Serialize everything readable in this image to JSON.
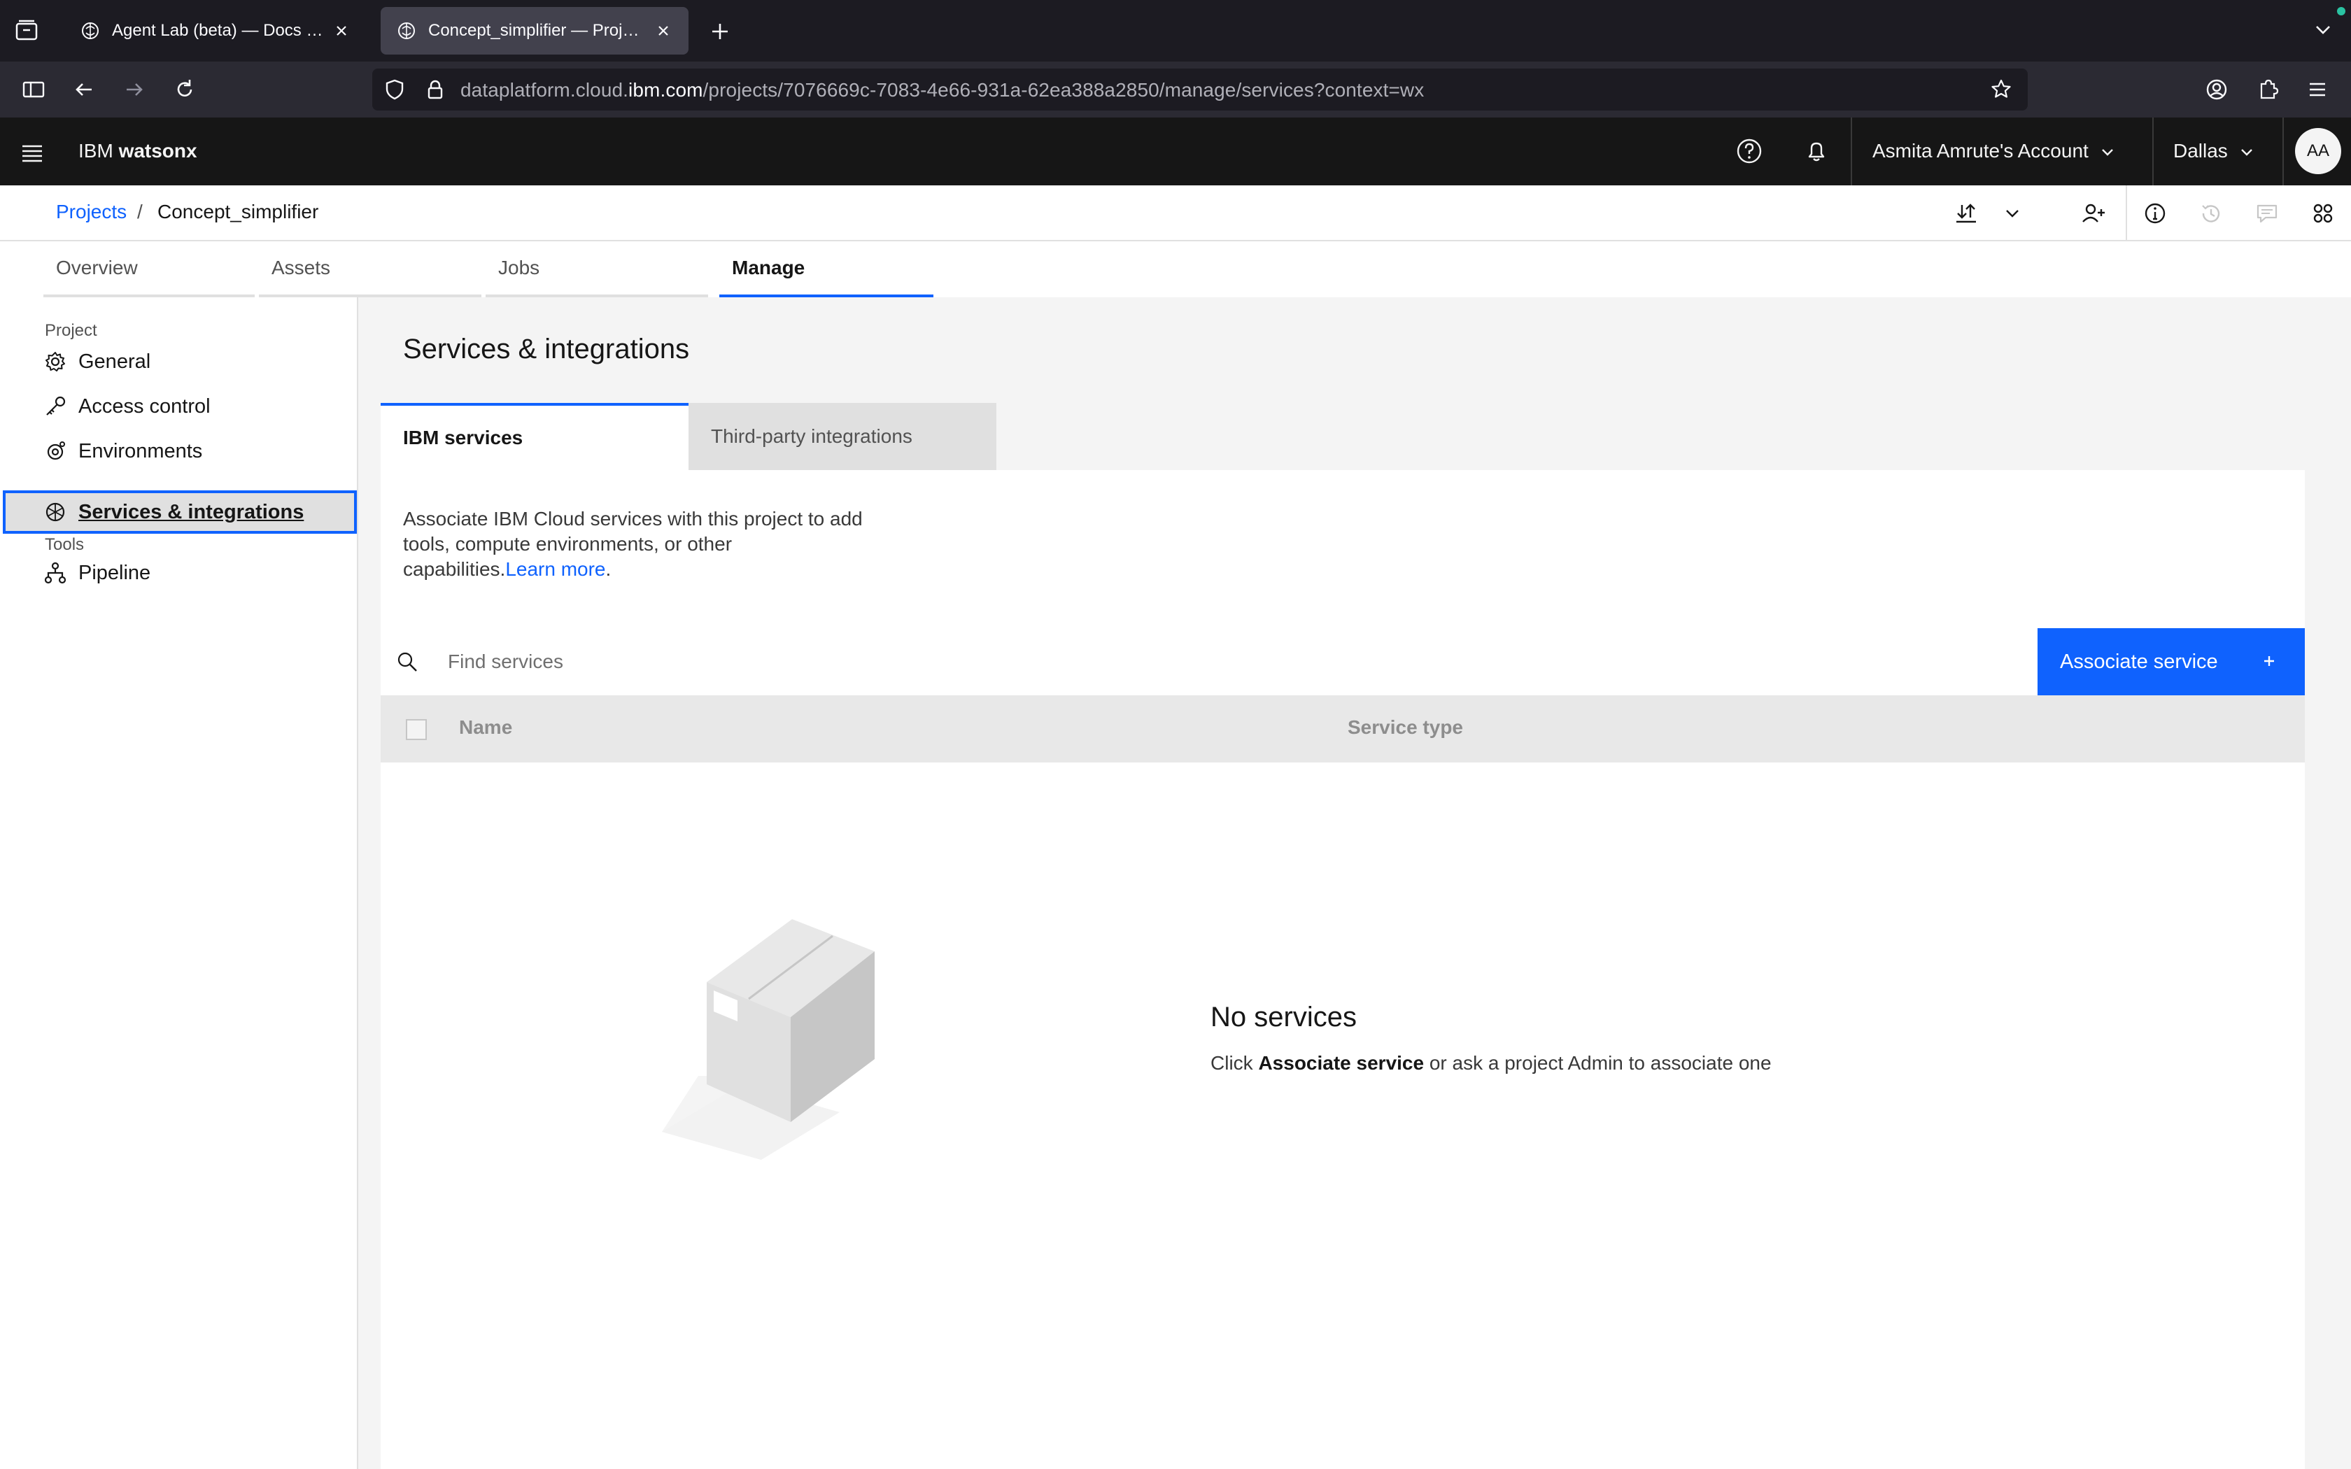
{
  "browser": {
    "tabs": [
      {
        "title": "Agent Lab (beta) — Docs | IBM watsonx",
        "active": false
      },
      {
        "title": "Concept_simplifier — Projects | IBM watsonx",
        "active": true
      }
    ],
    "url_prefix": "dataplatform.cloud.",
    "url_domain": "ibm.com",
    "url_path": "/projects/7076669c-7083-4e66-931a-62ea388a2850/manage/services?context=wx"
  },
  "header": {
    "brand_prefix": "IBM ",
    "brand_name": "watsonx",
    "account": "Asmita Amrute's Account",
    "region": "Dallas",
    "avatar_initials": "AA"
  },
  "breadcrumb": {
    "root": "Projects",
    "separator": "/",
    "current": "Concept_simplifier"
  },
  "project_tabs": [
    "Overview",
    "Assets",
    "Jobs",
    "Manage"
  ],
  "sidebar": {
    "project_heading": "Project",
    "project_items": [
      {
        "label": "General",
        "icon": "gear-icon"
      },
      {
        "label": "Access control",
        "icon": "key-icon"
      },
      {
        "label": "Environments",
        "icon": "environment-icon"
      },
      {
        "label": "Services & integrations",
        "icon": "services-icon",
        "selected": true
      }
    ],
    "tools_heading": "Tools",
    "tools_items": [
      {
        "label": "Pipeline",
        "icon": "pipeline-icon"
      }
    ]
  },
  "main": {
    "title": "Services & integrations",
    "tabs": [
      "IBM services",
      "Third-party integrations"
    ],
    "description": "Associate IBM Cloud services with this project to add tools, compute environments, or other capabilities.",
    "learn_more": "Learn more",
    "learn_more_suffix": ".",
    "search_placeholder": "Find services",
    "associate_button": "Associate service",
    "table_headers": [
      "Name",
      "Service type"
    ],
    "empty_title": "No services",
    "empty_sub_prefix": "Click ",
    "empty_sub_bold": "Associate service",
    "empty_sub_suffix": " or ask a project Admin to associate one"
  },
  "colors": {
    "accent": "#0f62fe",
    "header_bg": "#161616",
    "browser_bg": "#1c1b22"
  }
}
